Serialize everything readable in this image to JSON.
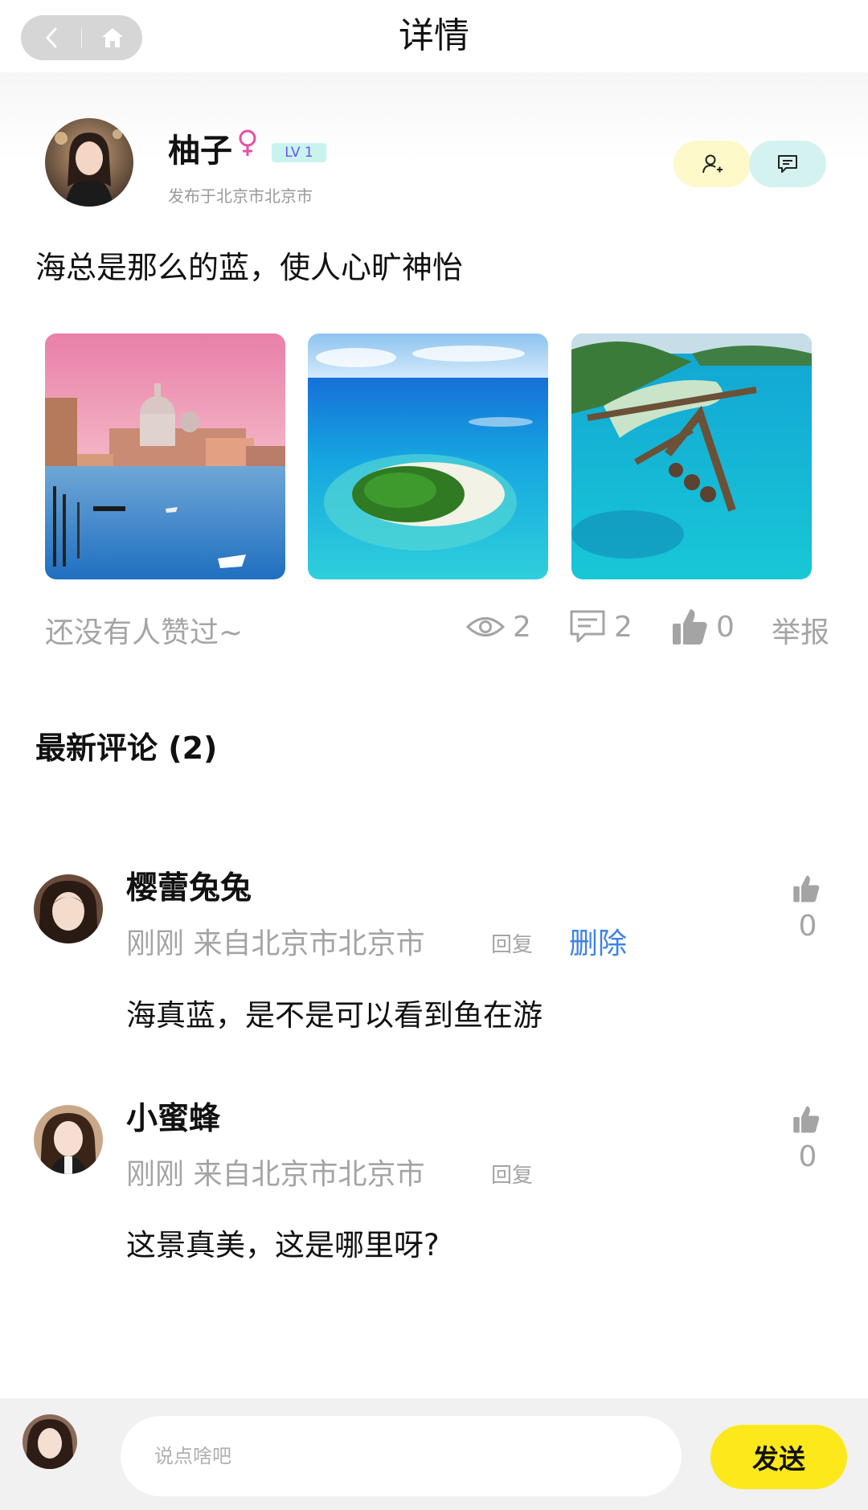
{
  "header": {
    "title": "详情",
    "back_icon": "chevron-left-icon",
    "home_icon": "home-icon"
  },
  "author": {
    "name": "柚子",
    "gender_symbol": "♀",
    "level": "LV 1",
    "location": "发布于北京市北京市",
    "follow_icon": "person-add-icon",
    "message_icon": "message-icon"
  },
  "post": {
    "text": "海总是那么的蓝，使人心旷神怡",
    "images": [
      "venice-canal-photo",
      "tropical-island-photo",
      "overwater-bungalows-photo"
    ]
  },
  "stats": {
    "likes_text": "还没有人赞过~",
    "views": "2",
    "comments": "2",
    "likes": "0",
    "report_label": "举报"
  },
  "comments_section": {
    "title": "最新评论 (2)"
  },
  "comments": [
    {
      "name": "樱蕾兔兔",
      "meta": "刚刚 来自北京市北京市",
      "reply_label": "回复",
      "delete_label": "删除",
      "text": "海真蓝，是不是可以看到鱼在游",
      "likes": "0"
    },
    {
      "name": "小蜜蜂",
      "meta": "刚刚 来自北京市北京市",
      "reply_label": "回复",
      "text": "这景真美，这是哪里呀?",
      "likes": "0"
    }
  ],
  "composer": {
    "placeholder": "说点啥吧",
    "send_label": "发送"
  },
  "colors": {
    "accent_yellow": "#fde81b",
    "link_blue": "#3d82e8",
    "muted": "#a4a4a4",
    "gender_pink": "#e84fa6"
  }
}
